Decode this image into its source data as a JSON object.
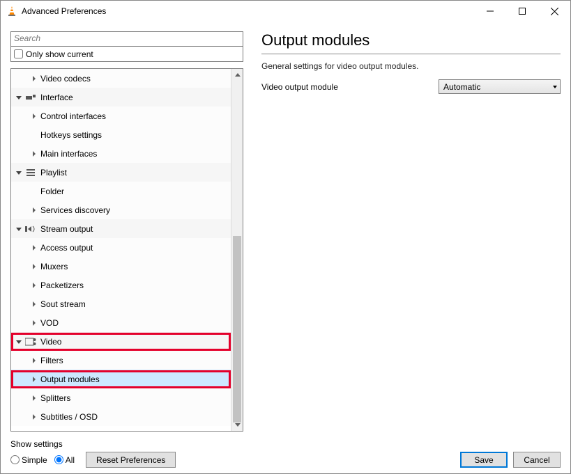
{
  "window": {
    "title": "Advanced Preferences"
  },
  "search": {
    "placeholder": "Search"
  },
  "only_current_label": "Only show current",
  "tree": {
    "video_codecs": "Video codecs",
    "interface": "Interface",
    "control_interfaces": "Control interfaces",
    "hotkeys_settings": "Hotkeys settings",
    "main_interfaces": "Main interfaces",
    "playlist": "Playlist",
    "folder": "Folder",
    "services_discovery": "Services discovery",
    "stream_output": "Stream output",
    "access_output": "Access output",
    "muxers": "Muxers",
    "packetizers": "Packetizers",
    "sout_stream": "Sout stream",
    "vod": "VOD",
    "video": "Video",
    "filters": "Filters",
    "output_modules": "Output modules",
    "splitters": "Splitters",
    "subtitles_osd": "Subtitles / OSD"
  },
  "page": {
    "title": "Output modules",
    "description": "General settings for video output modules.",
    "setting_label": "Video output module",
    "setting_value": "Automatic"
  },
  "footer": {
    "show_settings": "Show settings",
    "simple": "Simple",
    "all": "All",
    "reset": "Reset Preferences",
    "save": "Save",
    "cancel": "Cancel"
  }
}
